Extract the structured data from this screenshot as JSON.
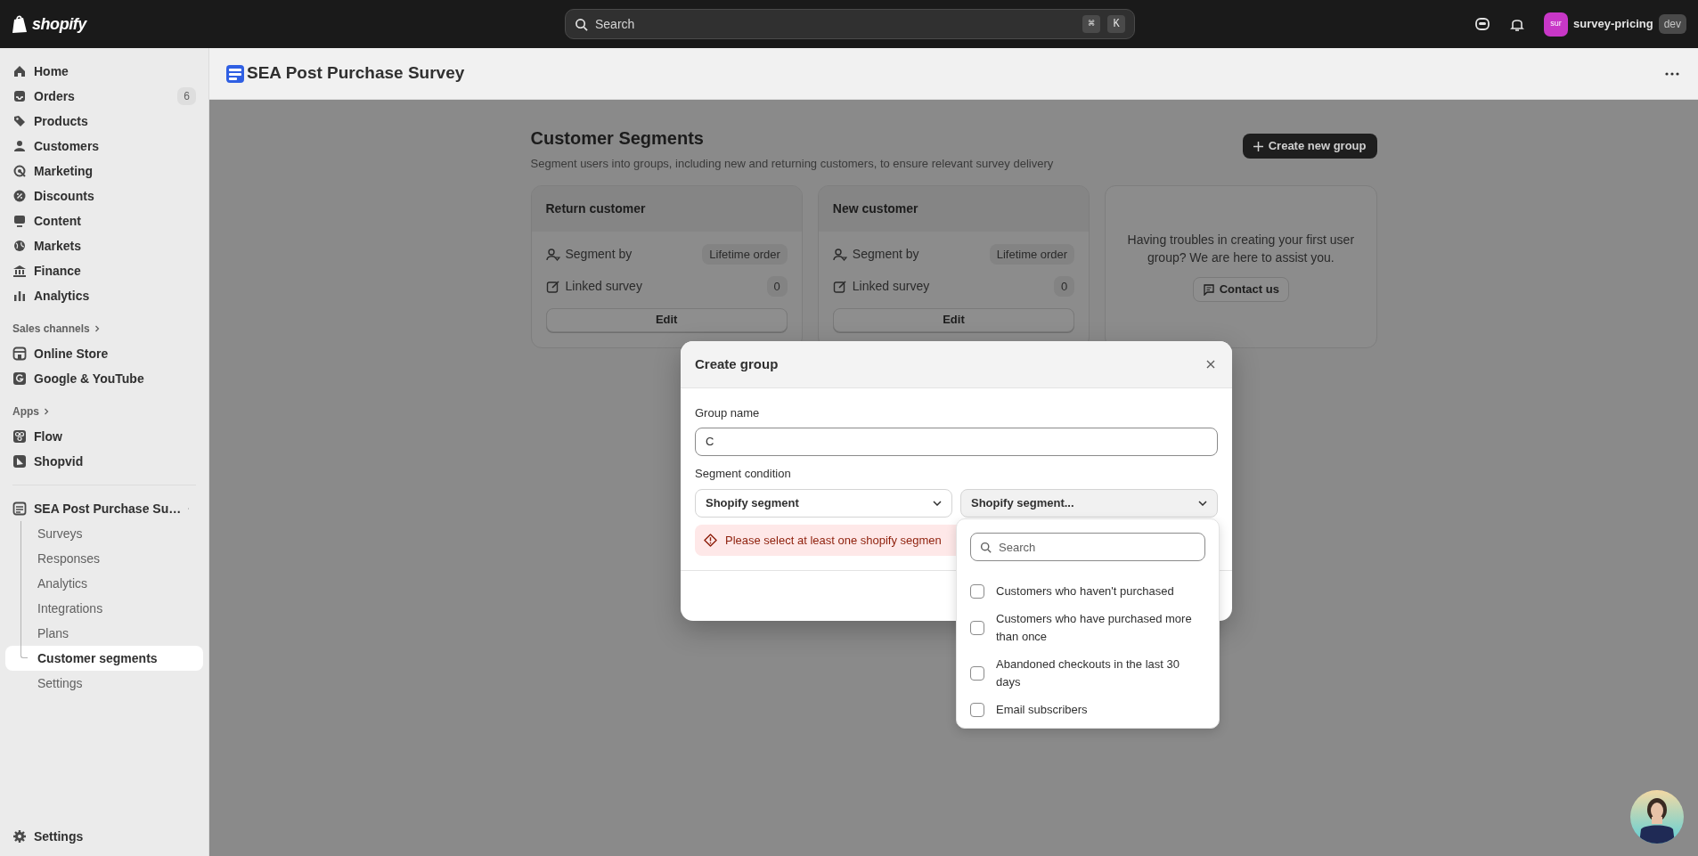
{
  "topbar": {
    "logo": "shopify",
    "search": {
      "placeholder": "Search"
    },
    "shortcut_keys": [
      "⌘",
      "K"
    ],
    "store": {
      "initials": "sur",
      "name": "survey-pricing",
      "badge": "dev"
    }
  },
  "sidebar": {
    "items": [
      {
        "label": "Home"
      },
      {
        "label": "Orders",
        "badge": "6"
      },
      {
        "label": "Products"
      },
      {
        "label": "Customers"
      },
      {
        "label": "Marketing"
      },
      {
        "label": "Discounts"
      },
      {
        "label": "Content"
      },
      {
        "label": "Markets"
      },
      {
        "label": "Finance"
      },
      {
        "label": "Analytics"
      }
    ],
    "sections": [
      {
        "title": "Sales channels",
        "items": [
          {
            "label": "Online Store"
          },
          {
            "label": "Google & YouTube"
          }
        ]
      },
      {
        "title": "Apps",
        "items": [
          {
            "label": "Flow"
          },
          {
            "label": "Shopvid"
          }
        ]
      }
    ],
    "app": {
      "label": "SEA Post Purchase Su…",
      "children": [
        {
          "label": "Surveys",
          "selected": false
        },
        {
          "label": "Responses",
          "selected": false
        },
        {
          "label": "Analytics",
          "selected": false
        },
        {
          "label": "Integrations",
          "selected": false
        },
        {
          "label": "Plans",
          "selected": false
        },
        {
          "label": "Customer segments",
          "selected": true
        },
        {
          "label": "Settings",
          "selected": false
        }
      ]
    },
    "footer": "Settings"
  },
  "app_header": {
    "title": "SEA Post Purchase Survey"
  },
  "page": {
    "title": "Customer Segments",
    "subtitle": "Segment users into groups, including new and returning customers, to ensure relevant survey delivery",
    "create_button": "Create new group",
    "cards": [
      {
        "title": "Return customer",
        "rows": [
          {
            "label": "Segment by",
            "value": "Lifetime order"
          },
          {
            "label": "Linked survey",
            "value": "0"
          }
        ],
        "button": "Edit"
      },
      {
        "title": "New customer",
        "rows": [
          {
            "label": "Segment by",
            "value": "Lifetime order"
          },
          {
            "label": "Linked survey",
            "value": "0"
          }
        ],
        "button": "Edit"
      }
    ],
    "help": {
      "text": "Having troubles in creating your first user group? We are here to assist you.",
      "button": "Contact us"
    }
  },
  "modal": {
    "title": "Create group",
    "group_name": {
      "label": "Group name",
      "value": "C"
    },
    "segment_condition": {
      "label": "Segment condition",
      "type_select": "Shopify segment",
      "segment_select": "Shopify segment..."
    },
    "error": "Please select at least one shopify segmen",
    "dropdown": {
      "search": {
        "placeholder": "Search"
      },
      "options": [
        {
          "label": "Customers who haven't purchased",
          "checked": false
        },
        {
          "label": "Customers who have purchased more than once",
          "checked": false
        },
        {
          "label": "Abandoned checkouts in the last 30 days",
          "checked": false
        },
        {
          "label": "Email subscribers",
          "checked": false
        }
      ]
    }
  }
}
